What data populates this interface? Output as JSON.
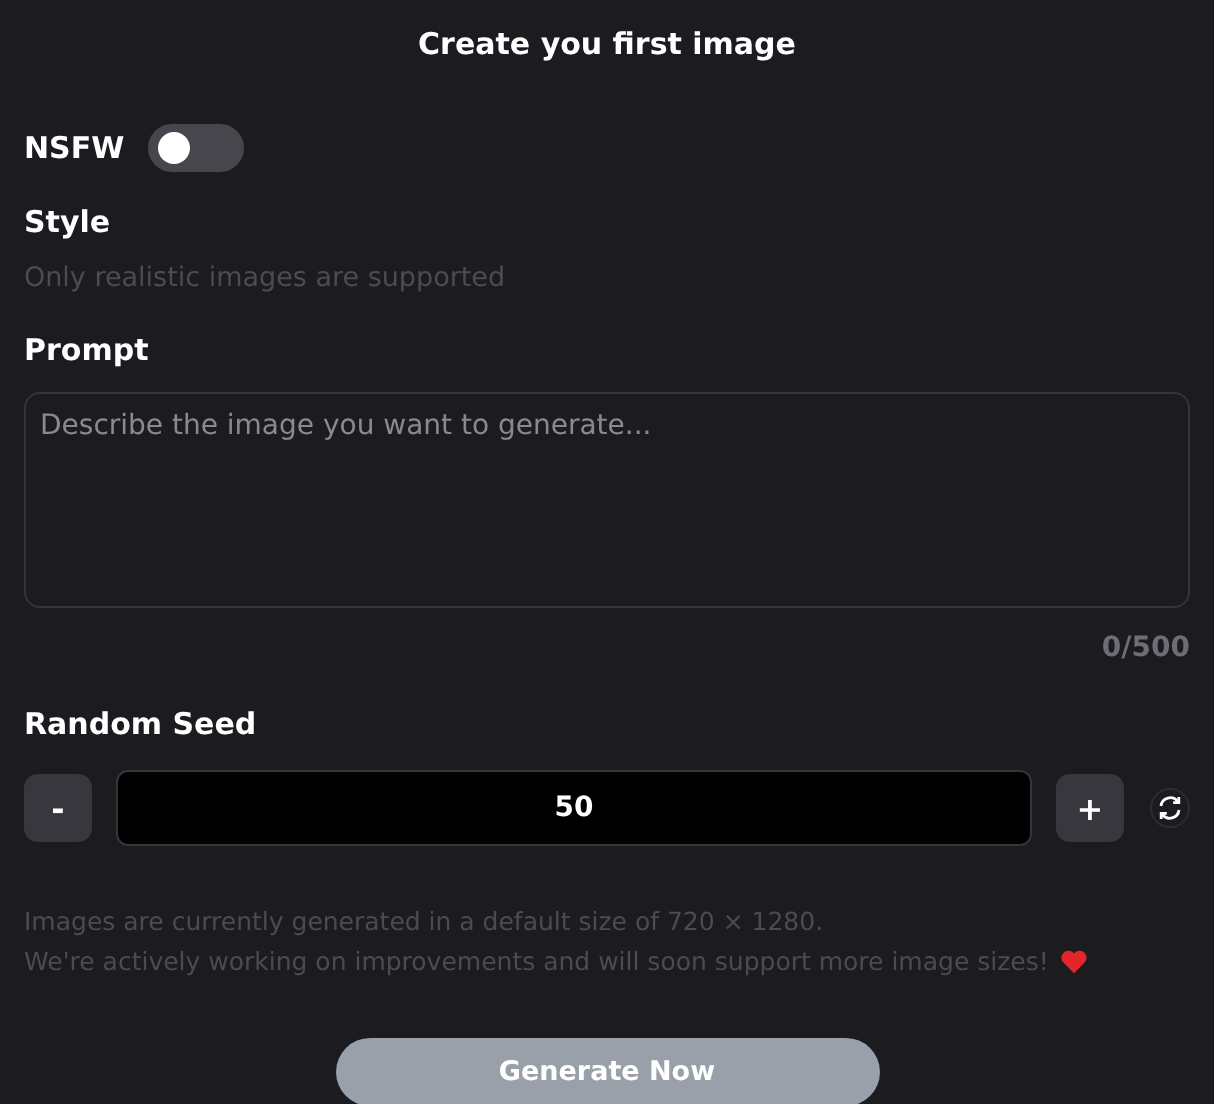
{
  "title": "Create you first image",
  "nsfw": {
    "label": "NSFW",
    "on": false
  },
  "style": {
    "label": "Style",
    "hint": "Only realistic images are supported"
  },
  "prompt": {
    "label": "Prompt",
    "placeholder": "Describe the image you want to generate...",
    "counter": "0/500"
  },
  "seed": {
    "label": "Random Seed",
    "minus": "-",
    "value": "50",
    "plus": "+"
  },
  "info": [
    "Images are currently generated in a default size of 720 × 1280.",
    "We're actively working on improvements and will soon support more image sizes!"
  ],
  "generate_button": "Generate Now"
}
